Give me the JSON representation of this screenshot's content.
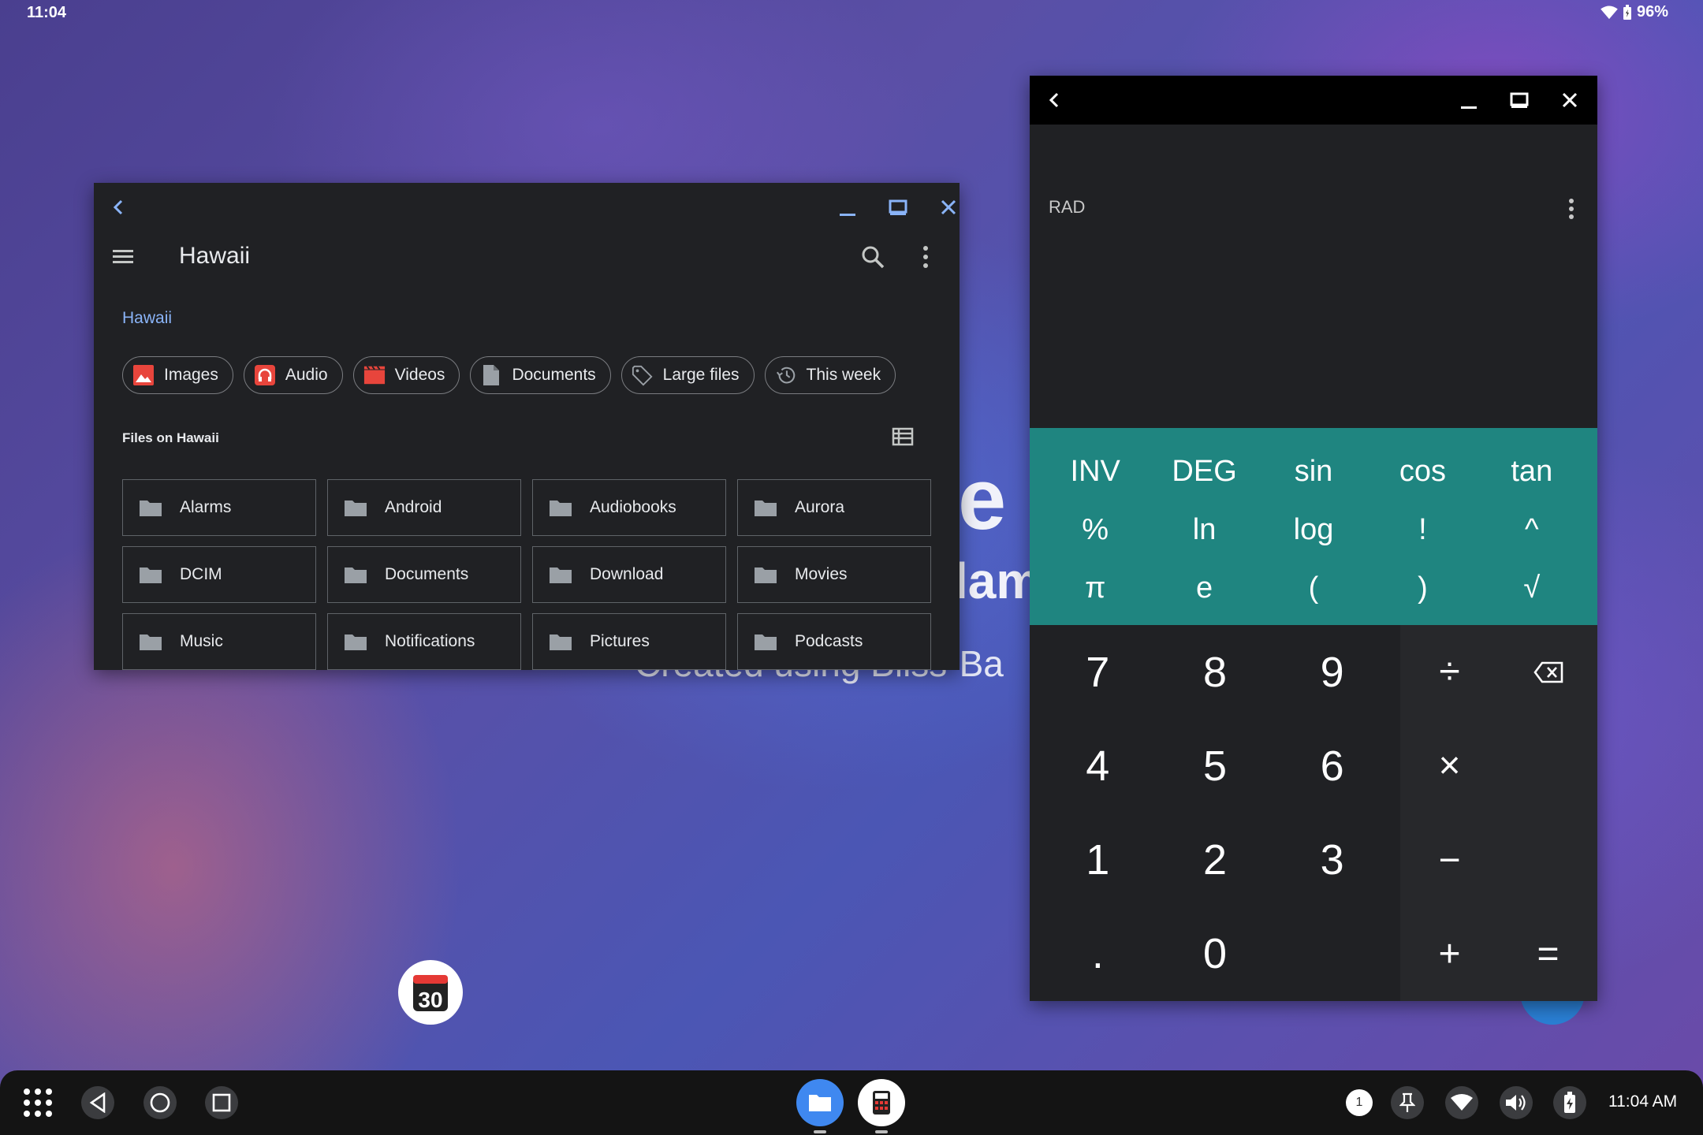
{
  "status_bar": {
    "time": "11:04",
    "battery": "96%"
  },
  "background": {
    "line1": "e",
    "line2": "lam",
    "line3": "Created using Bliss-Ba"
  },
  "desktop": {
    "calendar_day": "30"
  },
  "files": {
    "window_title": "Hawaii",
    "breadcrumb": "Hawaii",
    "chips": [
      {
        "label": "Images",
        "icon": "image-icon"
      },
      {
        "label": "Audio",
        "icon": "audio-icon"
      },
      {
        "label": "Videos",
        "icon": "video-icon"
      },
      {
        "label": "Documents",
        "icon": "document-icon"
      },
      {
        "label": "Large files",
        "icon": "tag-icon"
      },
      {
        "label": "This week",
        "icon": "history-icon"
      }
    ],
    "section_label": "Files on Hawaii",
    "folders": [
      "Alarms",
      "Android",
      "Audiobooks",
      "Aurora",
      "DCIM",
      "Documents",
      "Download",
      "Movies",
      "Music",
      "Notifications",
      "Pictures",
      "Podcasts"
    ],
    "colors": {
      "accent": "#8ab4f8",
      "image": "#e8453c"
    }
  },
  "calculator": {
    "angle_mode": "RAD",
    "advanced_keys": [
      "INV",
      "DEG",
      "sin",
      "cos",
      "tan",
      "%",
      "ln",
      "log",
      "!",
      "^",
      "π",
      "e",
      "(",
      ")",
      "√"
    ],
    "number_keys": [
      "7",
      "8",
      "9",
      "4",
      "5",
      "6",
      "1",
      "2",
      "3",
      ".",
      "0",
      ""
    ],
    "operator_keys": [
      "÷",
      "⌫",
      "×",
      "",
      "−",
      "",
      "+",
      "="
    ],
    "colors": {
      "advanced_panel": "#1f8580"
    }
  },
  "taskbar": {
    "time": "11:04 AM",
    "notification_count": "1"
  }
}
